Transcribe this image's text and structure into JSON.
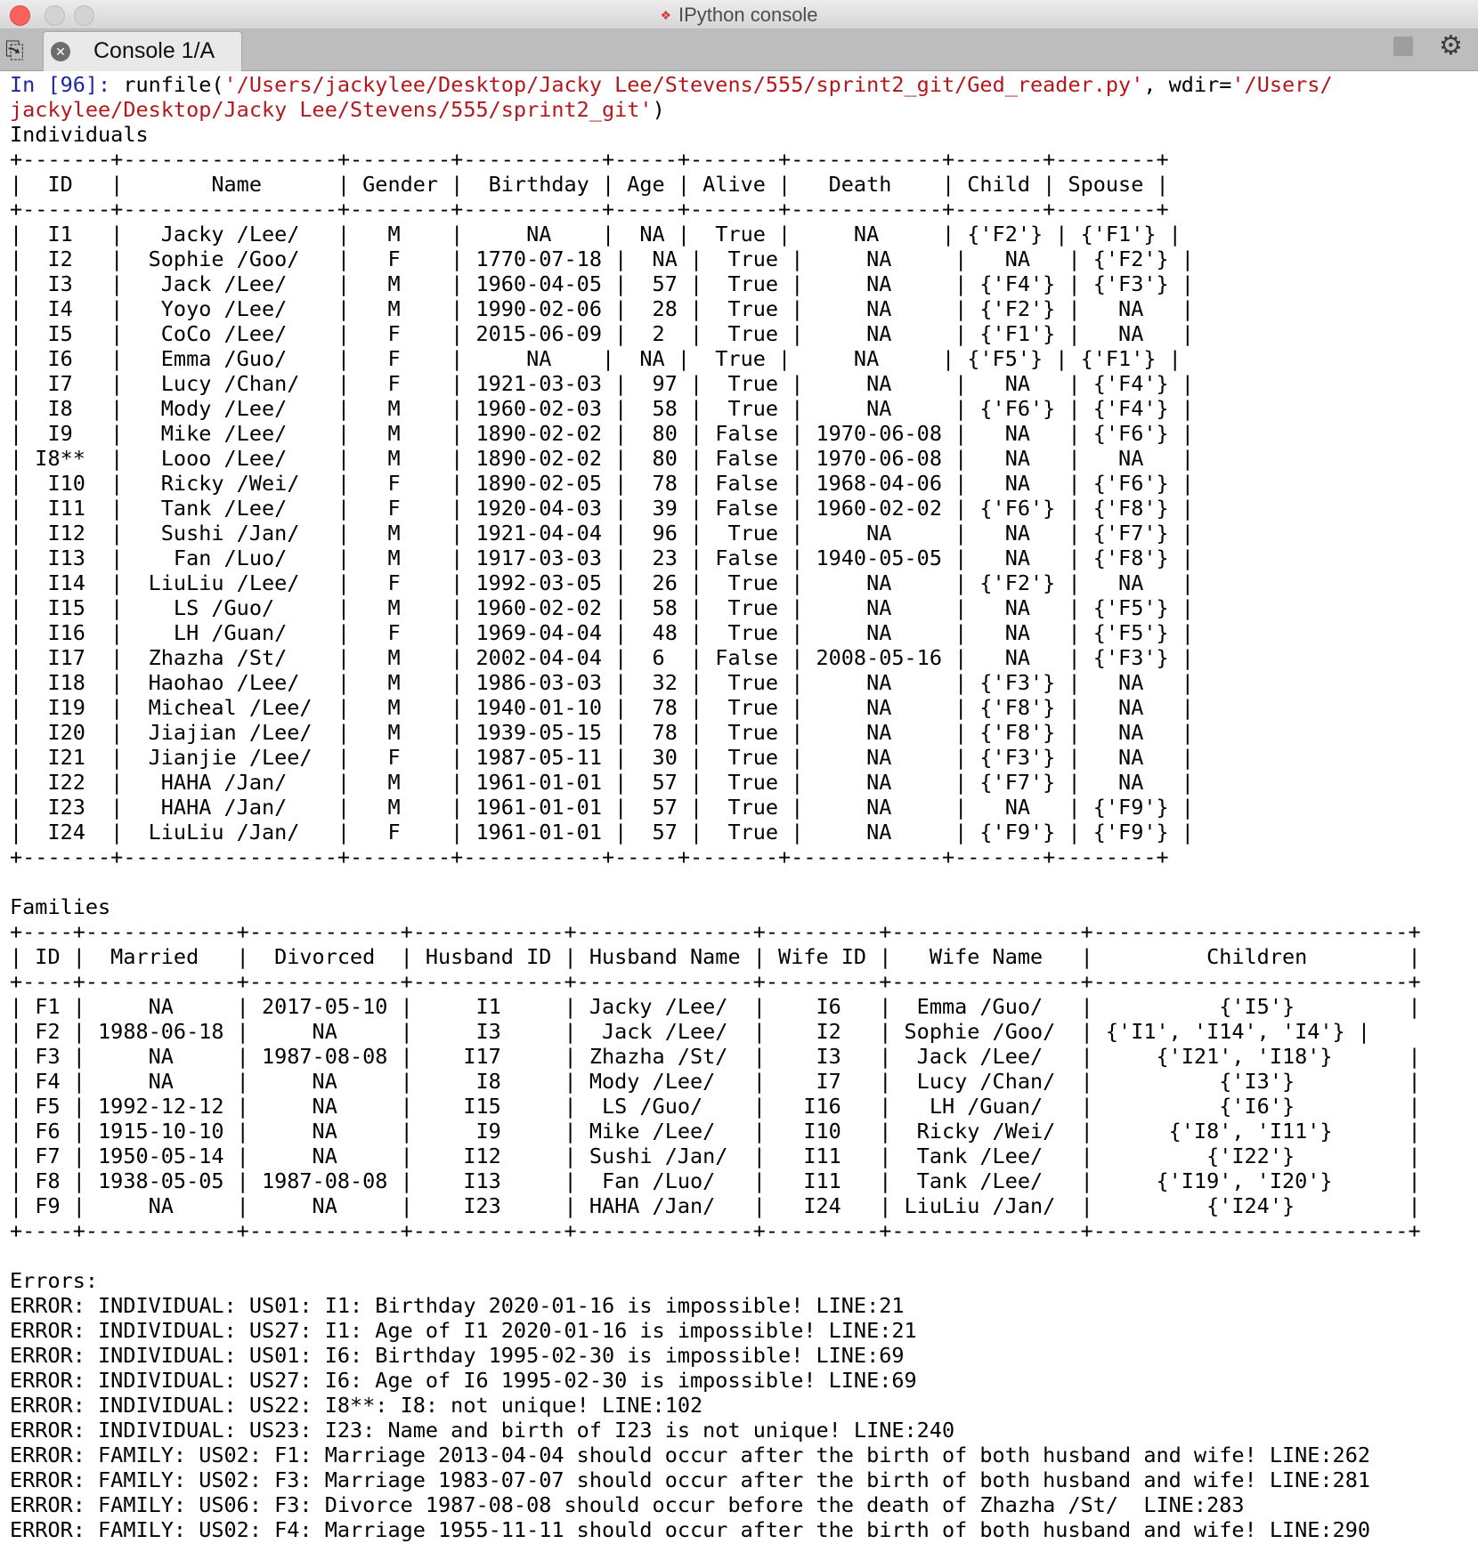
{
  "window": {
    "title": "IPython console",
    "icon": "python-icon",
    "tab_label": "Console 1/A",
    "tab_close_icon": "close-icon",
    "options_icon": "tab-options-icon",
    "stop_icon": "stop-icon",
    "settings_icon": "gear-icon"
  },
  "colors": {
    "prompt": "#1b26a8",
    "string": "#b3181d",
    "close_button": "#fc615d"
  },
  "console": {
    "prompt_in": "In [",
    "prompt_num": "96",
    "prompt_close": "]: ",
    "cmd_runfile": "runfile(",
    "cmd_path": "'/Users/jackylee/Desktop/Jacky Lee/Stevens/555/sprint2_git/Ged_reader.py'",
    "cmd_sep": ", wdir=",
    "cmd_wdir_part1": "'/Users/",
    "cmd_wdir_part2": "jackylee/Desktop/Jacky Lee/Stevens/555/sprint2_git'",
    "cmd_end": ")",
    "output_lines": [
      "Individuals",
      "+-------+-----------------+--------+-----------+-----+-------+------------+-------+--------+",
      "|  ID   |       Name      | Gender |  Birthday | Age | Alive |   Death    | Child | Spouse |",
      "+-------+-----------------+--------+-----------+-----+-------+------------+-------+--------+",
      "|  I1   |   Jacky /Lee/   |   M    |     NA    |  NA |  True |     NA     | {'F2'} | {'F1'} |",
      "|  I2   |  Sophie /Goo/   |   F    | 1770-07-18 |  NA |  True |     NA     |   NA   | {'F2'} |",
      "|  I3   |   Jack /Lee/    |   M    | 1960-04-05 |  57 |  True |     NA     | {'F4'} | {'F3'} |",
      "|  I4   |   Yoyo /Lee/    |   M    | 1990-02-06 |  28 |  True |     NA     | {'F2'} |   NA   |",
      "|  I5   |   CoCo /Lee/    |   F    | 2015-06-09 |  2  |  True |     NA     | {'F1'} |   NA   |",
      "|  I6   |   Emma /Guo/    |   F    |     NA    |  NA |  True |     NA     | {'F5'} | {'F1'} |",
      "|  I7   |   Lucy /Chan/   |   F    | 1921-03-03 |  97 |  True |     NA     |   NA   | {'F4'} |",
      "|  I8   |   Mody /Lee/    |   M    | 1960-02-03 |  58 |  True |     NA     | {'F6'} | {'F4'} |",
      "|  I9   |   Mike /Lee/    |   M    | 1890-02-02 |  80 | False | 1970-06-08 |   NA   | {'F6'} |",
      "| I8**  |   Looo /Lee/    |   M    | 1890-02-02 |  80 | False | 1970-06-08 |   NA   |   NA   |",
      "|  I10  |   Ricky /Wei/   |   F    | 1890-02-05 |  78 | False | 1968-04-06 |   NA   | {'F6'} |",
      "|  I11  |   Tank /Lee/    |   F    | 1920-04-03 |  39 | False | 1960-02-02 | {'F6'} | {'F8'} |",
      "|  I12  |   Sushi /Jan/   |   M    | 1921-04-04 |  96 |  True |     NA     |   NA   | {'F7'} |",
      "|  I13  |    Fan /Luo/    |   M    | 1917-03-03 |  23 | False | 1940-05-05 |   NA   | {'F8'} |",
      "|  I14  |  LiuLiu /Lee/   |   F    | 1992-03-05 |  26 |  True |     NA     | {'F2'} |   NA   |",
      "|  I15  |    LS /Guo/     |   M    | 1960-02-02 |  58 |  True |     NA     |   NA   | {'F5'} |",
      "|  I16  |    LH /Guan/    |   F    | 1969-04-04 |  48 |  True |     NA     |   NA   | {'F5'} |",
      "|  I17  |  Zhazha /St/    |   M    | 2002-04-04 |  6  | False | 2008-05-16 |   NA   | {'F3'} |",
      "|  I18  |  Haohao /Lee/   |   M    | 1986-03-03 |  32 |  True |     NA     | {'F3'} |   NA   |",
      "|  I19  |  Micheal /Lee/  |   M    | 1940-01-10 |  78 |  True |     NA     | {'F8'} |   NA   |",
      "|  I20  |  Jiajian /Lee/  |   M    | 1939-05-15 |  78 |  True |     NA     | {'F8'} |   NA   |",
      "|  I21  |  Jianjie /Lee/  |   F    | 1987-05-11 |  30 |  True |     NA     | {'F3'} |   NA   |",
      "|  I22  |   HAHA /Jan/    |   M    | 1961-01-01 |  57 |  True |     NA     | {'F7'} |   NA   |",
      "|  I23  |   HAHA /Jan/    |   M    | 1961-01-01 |  57 |  True |     NA     |   NA   | {'F9'} |",
      "|  I24  |  LiuLiu /Jan/   |   F    | 1961-01-01 |  57 |  True |     NA     | {'F9'} | {'F9'} |",
      "+-------+-----------------+--------+-----------+-----+-------+------------+-------+--------+",
      "",
      "Families",
      "+----+------------+------------+------------+--------------+---------+---------------+-------------------------+",
      "| ID |  Married   |  Divorced  | Husband ID | Husband Name | Wife ID |   Wife Name   |         Children        |",
      "+----+------------+------------+------------+--------------+---------+---------------+-------------------------+",
      "| F1 |     NA     | 2017-05-10 |     I1     | Jacky /Lee/  |    I6   |  Emma /Guo/   |          {'I5'}         |",
      "| F2 | 1988-06-18 |     NA     |     I3     |  Jack /Lee/  |    I2   | Sophie /Goo/  | {'I1', 'I14', 'I4'} |",
      "| F3 |     NA     | 1987-08-08 |    I17     | Zhazha /St/  |    I3   |  Jack /Lee/   |     {'I21', 'I18'}      |",
      "| F4 |     NA     |     NA     |     I8     | Mody /Lee/   |    I7   |  Lucy /Chan/  |          {'I3'}         |",
      "| F5 | 1992-12-12 |     NA     |    I15     |  LS /Guo/    |   I16   |   LH /Guan/   |          {'I6'}         |",
      "| F6 | 1915-10-10 |     NA     |     I9     | Mike /Lee/   |   I10   |  Ricky /Wei/  |      {'I8', 'I11'}      |",
      "| F7 | 1950-05-14 |     NA     |    I12     | Sushi /Jan/  |   I11   |  Tank /Lee/   |         {'I22'}         |",
      "| F8 | 1938-05-05 | 1987-08-08 |    I13     |  Fan /Luo/   |   I11   |  Tank /Lee/   |     {'I19', 'I20'}      |",
      "| F9 |     NA     |     NA     |    I23     | HAHA /Jan/   |   I24   | LiuLiu /Jan/  |         {'I24'}         |",
      "+----+------------+------------+------------+--------------+---------+---------------+-------------------------+",
      "",
      "Errors:",
      "ERROR: INDIVIDUAL: US01: I1: Birthday 2020-01-16 is impossible! LINE:21",
      "ERROR: INDIVIDUAL: US27: I1: Age of I1 2020-01-16 is impossible! LINE:21",
      "ERROR: INDIVIDUAL: US01: I6: Birthday 1995-02-30 is impossible! LINE:69",
      "ERROR: INDIVIDUAL: US27: I6: Age of I6 1995-02-30 is impossible! LINE:69",
      "ERROR: INDIVIDUAL: US22: I8**: I8: not unique! LINE:102",
      "ERROR: INDIVIDUAL: US23: I23: Name and birth of I23 is not unique! LINE:240",
      "ERROR: FAMILY: US02: F1: Marriage 2013-04-04 should occur after the birth of both husband and wife! LINE:262",
      "ERROR: FAMILY: US02: F3: Marriage 1983-07-07 should occur after the birth of both husband and wife! LINE:281",
      "ERROR: FAMILY: US06: F3: Divorce 1987-08-08 should occur before the death of Zhazha /St/  LINE:283",
      "ERROR: FAMILY: US02: F4: Marriage 1955-11-11 should occur after the birth of both husband and wife! LINE:290"
    ]
  }
}
